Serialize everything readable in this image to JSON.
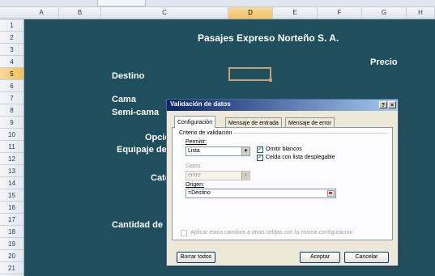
{
  "columns": [
    "A",
    "B",
    "C",
    "D",
    "E",
    "F",
    "G",
    "H"
  ],
  "selected_column": "D",
  "rows": [
    "1",
    "2",
    "3",
    "4",
    "5",
    "6",
    "7",
    "8",
    "9",
    "10",
    "11",
    "12",
    "13",
    "14",
    "15",
    "16",
    "17",
    "18",
    "19",
    "20",
    "21"
  ],
  "selected_row": "5",
  "sheet": {
    "bg_color": "#1f4f5c",
    "title": "Pasajes Expreso Norteño S. A.",
    "precio": "Precio",
    "destino": "Destino",
    "cama": "Cama",
    "semicama": "Semi-cama",
    "opcio": "Opcio",
    "equipaje": "Equipaje de",
    "cate": "Cate",
    "cantidad": "Cantidad de"
  },
  "dialog": {
    "title": "Validación de datos",
    "help_button": "?",
    "close_button": "×",
    "tabs": [
      "Configuración",
      "Mensaje de entrada",
      "Mensaje de error"
    ],
    "active_tab": "Configuración",
    "criteria_group": "Criterio de validación",
    "permitir_label": "Permitir:",
    "permitir_value": "Lista",
    "omitir_blancos": "Omitir blancos",
    "omitir_blancos_checked": true,
    "celda_con_lista": "Celda con lista desplegable",
    "celda_con_lista_checked": true,
    "datos_label": "Datos:",
    "datos_value": "entre",
    "origen_label": "Origen:",
    "origen_value": "=Destino",
    "aplicar_label": "Aplicar estos cambios a otras celdas con la misma configuración",
    "aplicar_checked": false,
    "borrar_todos": "Borrar todos",
    "aceptar": "Aceptar",
    "cancelar": "Cancelar"
  }
}
